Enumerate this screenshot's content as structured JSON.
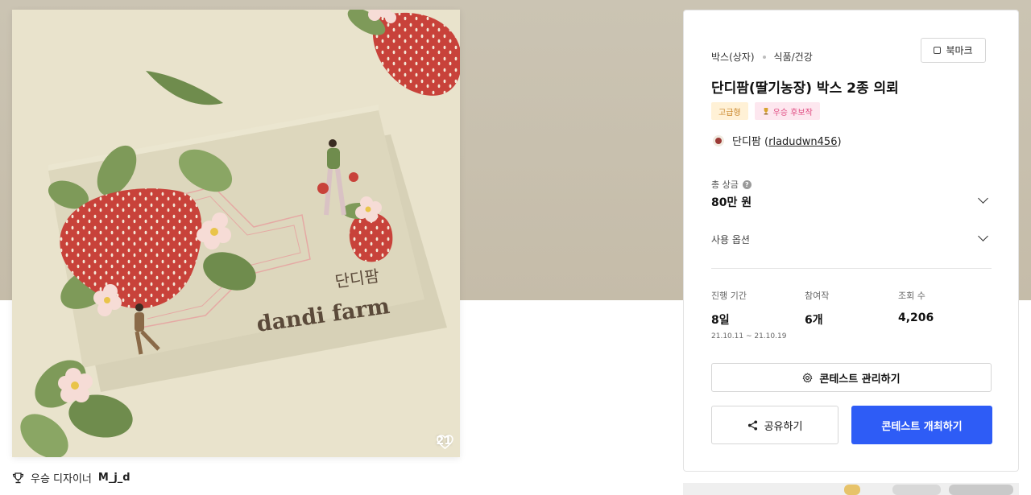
{
  "artwork": {
    "brand_korean": "단디팜",
    "brand_english": "dandi farm",
    "like_count": "21"
  },
  "designer": {
    "prefix": "우승 디자이너",
    "name": "M_j_d"
  },
  "contest": {
    "breadcrumb": [
      "박스(상자)",
      "식품/건강"
    ],
    "bookmark_label": "북마크",
    "title": "단디팜(딸기농장) 박스 2종 의뢰",
    "badges": {
      "grade": "고급형",
      "award": "우승 후보작"
    },
    "owner_name": "단디팜",
    "owner_id": "rladudwn456",
    "prize_label": "총 상금",
    "prize_value": "80만 원",
    "usage_label": "사용 옵션",
    "stats": {
      "period_label": "진행 기간",
      "period_value": "8일",
      "period_range": "21.10.11 ~ 21.10.19",
      "entries_label": "참여작",
      "entries_value": "6개",
      "views_label": "조회 수",
      "views_value": "4,206"
    },
    "manage_button": "콘테스트 관리하기",
    "share_button": "공유하기",
    "host_button": "콘테스트 개최하기"
  },
  "colors": {
    "primary": "#2e5cf6",
    "hero_bg": "#c8c0ae",
    "strawberry": "#c8423a",
    "leaf": "#7f9a5a"
  }
}
